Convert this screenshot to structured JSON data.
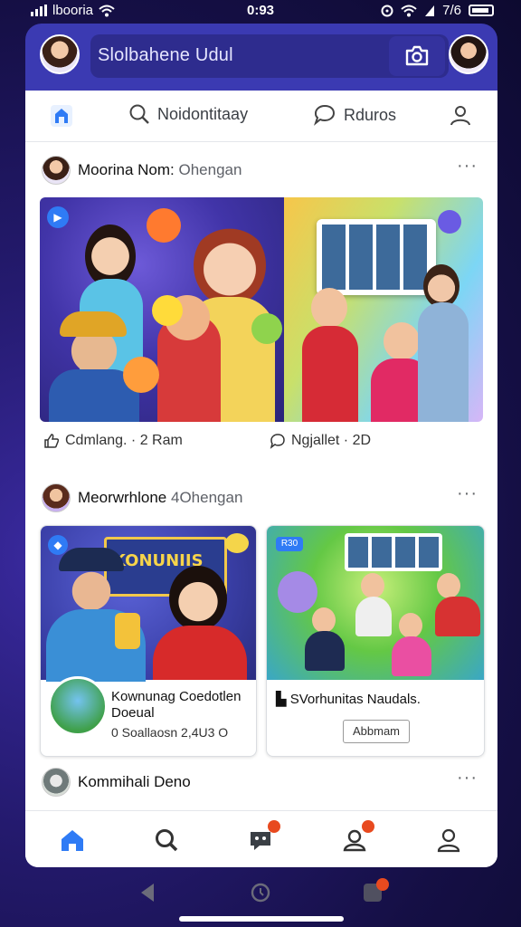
{
  "status_bar": {
    "carrier": "lbooria",
    "time": "0:93",
    "right_text": "7/6"
  },
  "header": {
    "search_text": "Slolbahene Udul"
  },
  "top_nav": {
    "item2": "Noidontitaay",
    "item3": "Rduros"
  },
  "post1": {
    "author": "Moorina Nom:",
    "sub": " Ohengan",
    "more": "···",
    "action_like": "Cdmlang. · 2 Ram",
    "action_comment": "Ngjallet · 2D"
  },
  "post2": {
    "author": "Meorwrhlone",
    "sub": " 4Ohengan",
    "more": "···",
    "card1_title": "Kownunag Coedotlen",
    "card1_title2": "Doeual",
    "card1_meta": "0 Soallaosn  2,4U3 O",
    "card1_banner": "KONUNIIS",
    "card2_title": "SVorhunitas Naudals.",
    "card2_button": "Abbmam",
    "card2_tag": "R30"
  },
  "post3": {
    "author": "Kommihali Deno",
    "more": "···"
  },
  "colors": {
    "accent": "#2f7bf5",
    "header": "#3b3ab2",
    "notification": "#e84a1f"
  }
}
